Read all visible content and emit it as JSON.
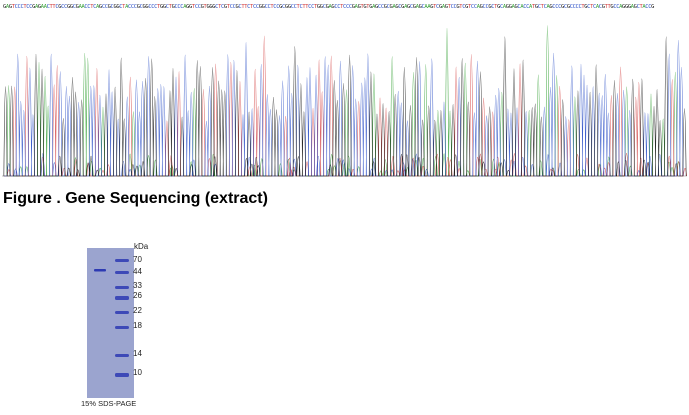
{
  "sequence_text": "GAGTCCCTCCGAGAACTTCGCCGGCGAACCTCAGCCGCGGCTACCCGCGGCCCTGGCTGCCCAGGTCCGTGGGCTCGTCCGCTTCTCCGGCCTCCGCGGCCTCTTCCTGGCGAGCCTCCCGAGTGTGAGCCGCGAGCGAGCGAGCAAGTCGAGTCCGTCGTCCAGCCGCTGCAGGAGCACCATGCTCAGCCCGCGCCCCTGCTCACGTTGCCAGGGAGCTACCG",
  "base_colors": {
    "A": "#2e9d2e",
    "C": "#2a4fc7",
    "G": "#111111",
    "T": "#d23a3a"
  },
  "figure_caption": "Figure . Gene Sequencing (extract)",
  "gel": {
    "unit_label": "kDa",
    "markers": [
      "70",
      "44",
      "33",
      "26",
      "22",
      "18",
      "14",
      "10"
    ],
    "caption": "15% SDS-PAGE",
    "background_color": "#9ba4cf",
    "band_color": "#2d3ab3"
  }
}
